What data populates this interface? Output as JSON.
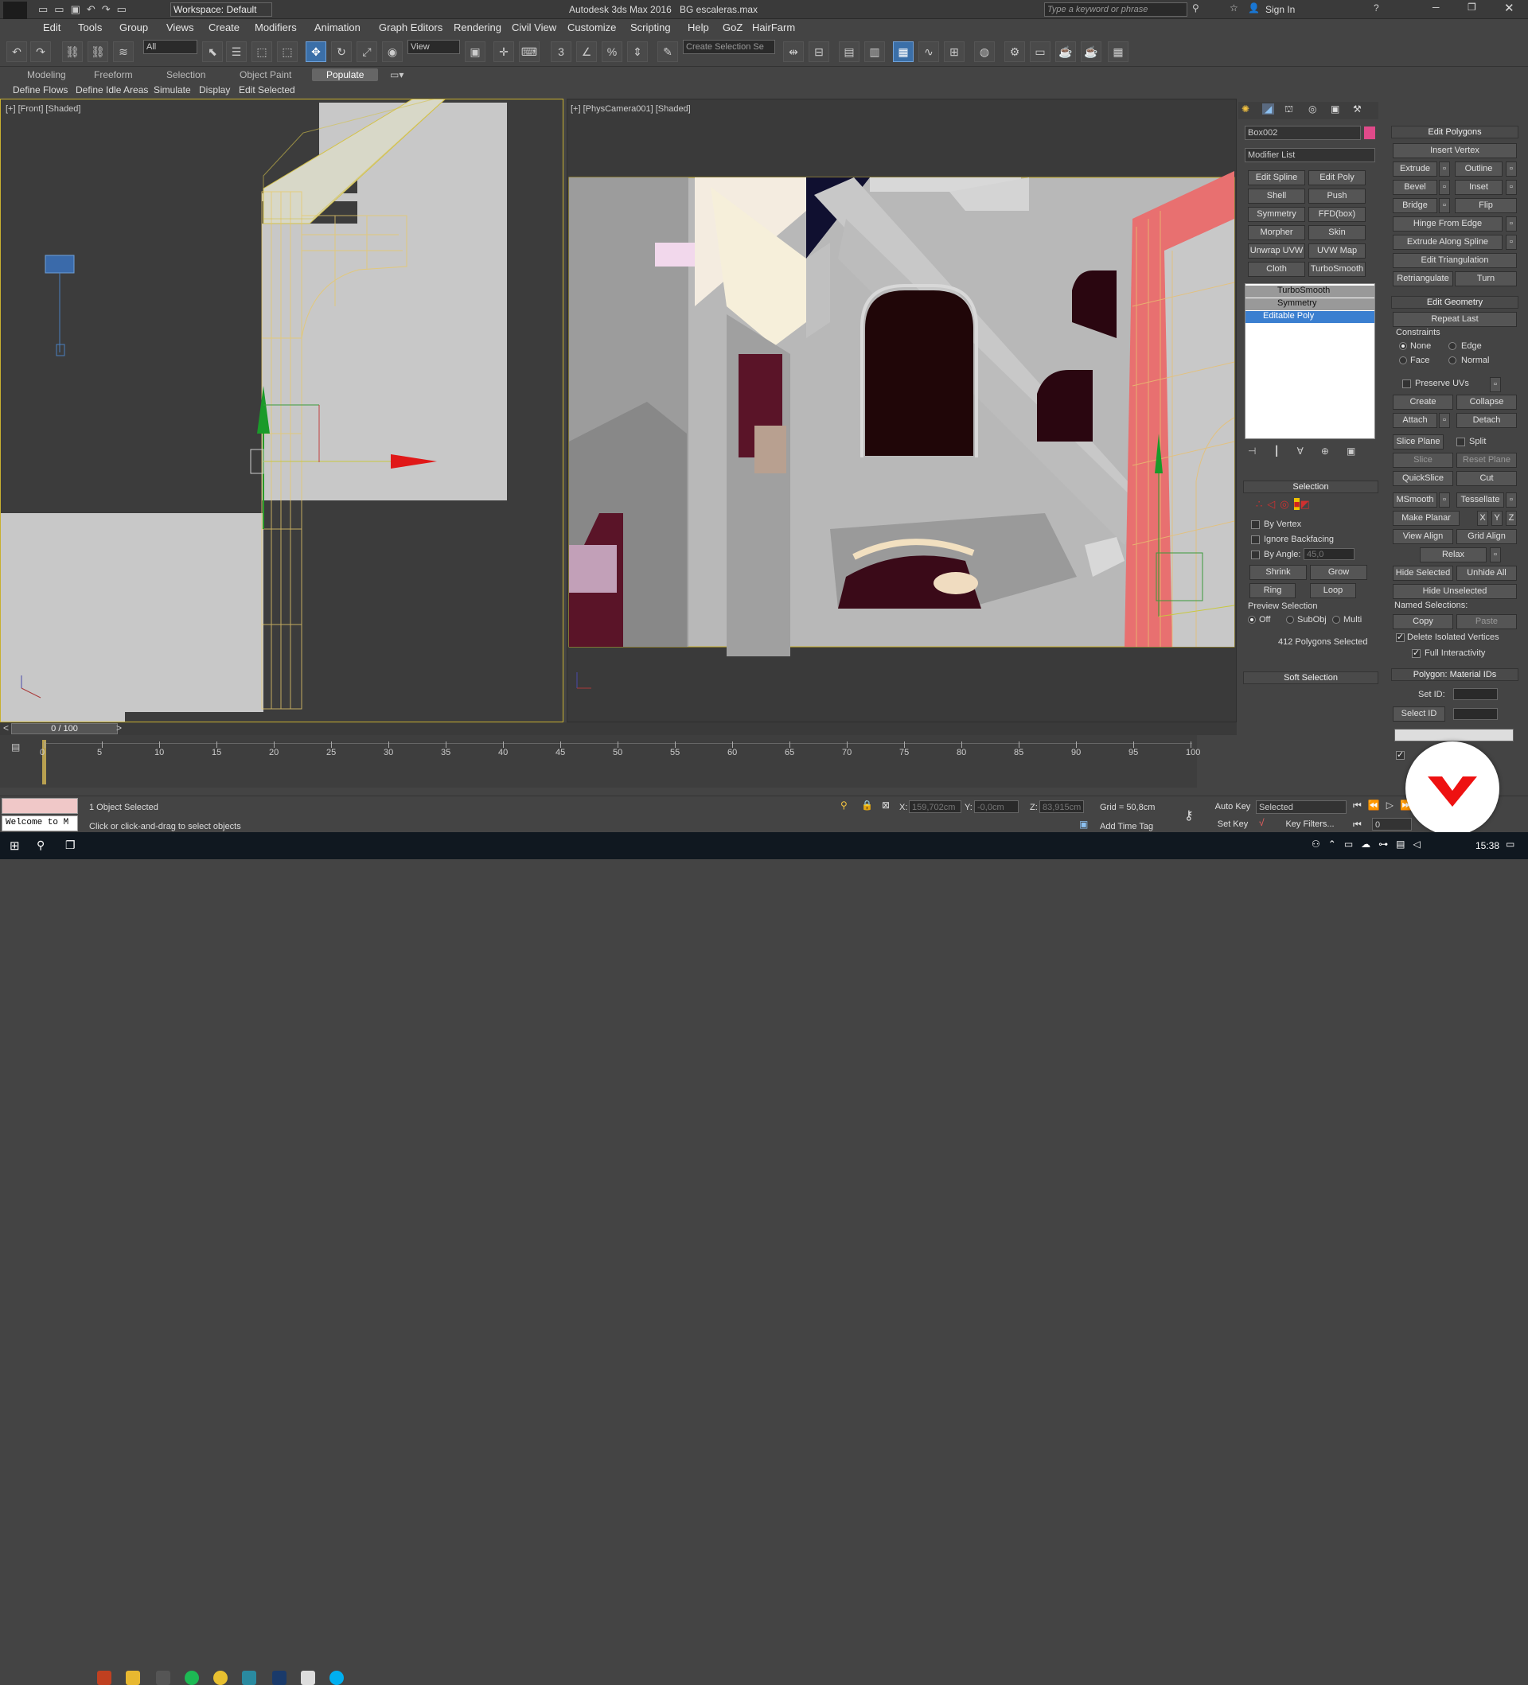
{
  "title": {
    "app": "Autodesk 3ds Max 2016",
    "file": "BG escaleras.max",
    "workspace": "Workspace: Default",
    "search_placeholder": "Type a keyword or phrase",
    "sign_in": "Sign In"
  },
  "menu": [
    "Edit",
    "Tools",
    "Group",
    "Views",
    "Create",
    "Modifiers",
    "Animation",
    "Graph Editors",
    "Rendering",
    "Civil View",
    "Customize",
    "Scripting",
    "Help",
    "GoZ",
    "HairFarm"
  ],
  "toolbar": {
    "filter": "All",
    "refcoord": "View",
    "named_sel": "Create Selection Se"
  },
  "ribbon": {
    "tabs": [
      "Modeling",
      "Freeform",
      "Selection",
      "Object Paint",
      "Populate"
    ],
    "subtabs": [
      "Define Flows",
      "Define Idle Areas",
      "Simulate",
      "Display",
      "Edit Selected"
    ]
  },
  "viewports": {
    "left_label": "[+] [Front] [Shaded]",
    "right_label": "[+] [PhysCamera001] [Shaded]"
  },
  "cmdpanel": {
    "object_name": "Box002",
    "object_color": "#e04a8a",
    "modifier_list": "Modifier List",
    "mod_buttons": [
      "Edit Spline",
      "Edit Poly",
      "Shell",
      "Push",
      "Symmetry",
      "FFD(box)",
      "Morpher",
      "Skin",
      "Unwrap UVW",
      "UVW Map",
      "Cloth",
      "TurboSmooth"
    ],
    "stack": [
      "TurboSmooth",
      "Symmetry",
      "Editable Poly"
    ],
    "selection": {
      "header": "Selection",
      "by_vertex": "By Vertex",
      "ignore_backfacing": "Ignore Backfacing",
      "by_angle": "By Angle:",
      "angle_value": "45,0",
      "shrink": "Shrink",
      "grow": "Grow",
      "ring": "Ring",
      "loop": "Loop",
      "preview": "Preview Selection",
      "off": "Off",
      "subobj": "SubObj",
      "multi": "Multi",
      "count": "412 Polygons Selected"
    },
    "soft_selection": "Soft Selection"
  },
  "edit_polygons": {
    "header": "Edit Polygons",
    "insert_vertex": "Insert Vertex",
    "extrude": "Extrude",
    "outline": "Outline",
    "bevel": "Bevel",
    "inset": "Inset",
    "bridge": "Bridge",
    "flip": "Flip",
    "hinge": "Hinge From Edge",
    "extrude_spline": "Extrude Along Spline",
    "edit_tri": "Edit Triangulation",
    "retri": "Retriangulate",
    "turn": "Turn"
  },
  "edit_geometry": {
    "header": "Edit Geometry",
    "repeat_last": "Repeat Last",
    "constraints": "Constraints",
    "none": "None",
    "edge": "Edge",
    "face": "Face",
    "normal": "Normal",
    "preserve_uvs": "Preserve UVs",
    "create": "Create",
    "collapse": "Collapse",
    "attach": "Attach",
    "detach": "Detach",
    "slice_plane": "Slice Plane",
    "split": "Split",
    "slice": "Slice",
    "reset_plane": "Reset Plane",
    "quickslice": "QuickSlice",
    "cut": "Cut",
    "msmooth": "MSmooth",
    "tessellate": "Tessellate",
    "make_planar": "Make Planar",
    "x": "X",
    "y": "Y",
    "z": "Z",
    "view_align": "View Align",
    "grid_align": "Grid Align",
    "relax": "Relax",
    "hide_selected": "Hide Selected",
    "unhide_all": "Unhide All",
    "hide_unselected": "Hide Unselected",
    "named_sel": "Named Selections:",
    "copy": "Copy",
    "paste": "Paste",
    "delete_iso": "Delete Isolated Vertices",
    "full_inter": "Full Interactivity"
  },
  "material_ids": {
    "header": "Polygon: Material IDs",
    "set_id": "Set ID:",
    "select_id": "Select ID"
  },
  "timeline": {
    "frame": "0 / 100",
    "ticks": [
      "0",
      "5",
      "10",
      "15",
      "20",
      "25",
      "30",
      "35",
      "40",
      "45",
      "50",
      "55",
      "60",
      "65",
      "70",
      "75",
      "80",
      "85",
      "90",
      "95",
      "100"
    ]
  },
  "status": {
    "maxscript": "Welcome to M",
    "selected": "1 Object Selected",
    "prompt": "Click or click-and-drag to select objects",
    "x": "159,702cm",
    "y": "-0,0cm",
    "z": "83,915cm",
    "grid": "Grid = 50,8cm",
    "add_time_tag": "Add Time Tag",
    "auto_key": "Auto Key",
    "set_key": "Set Key",
    "key_mode": "Selected",
    "key_filters": "Key Filters...",
    "frame_field": "0"
  },
  "taskbar": {
    "time": "15:38"
  }
}
